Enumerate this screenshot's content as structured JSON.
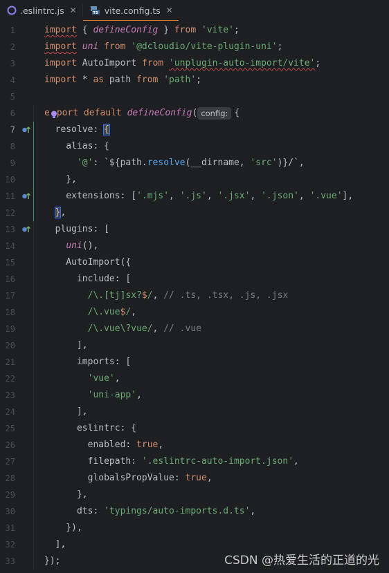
{
  "tabs": [
    {
      "label": ".eslintrc.js",
      "icon": "eslint-icon",
      "active": false
    },
    {
      "label": "vite.config.ts",
      "icon": "typescript-file-icon",
      "active": true
    }
  ],
  "tab_close_symbol": "✕",
  "watermark": "CSDN @热爱生活的正道的光",
  "inlay_hint": "config:",
  "current_line": 7,
  "gutter_markers": [
    7,
    11,
    13
  ],
  "lines": [
    {
      "n": 1,
      "html": "<span class='kw typo'>import</span> { <span class='fn'>defineConfig</span> } <span class='kw'>from</span> <span class='str'>'vite'</span>;"
    },
    {
      "n": 2,
      "html": "<span class='kw typo'>import</span> <span class='fn'>uni</span> <span class='kw'>from</span> <span class='str'>'@dcloudio/vite-plugin-uni'</span>;"
    },
    {
      "n": 3,
      "html": "<span class='kw'>import</span> AutoImport <span class='kw'>from</span> <span class='str typo'>'unplugin-auto-import/vite'</span>;"
    },
    {
      "n": 4,
      "html": "<span class='kw'>import</span> * <span class='kw'>as</span> path <span class='kw'>from</span> <span class='str'>'path'</span>;"
    },
    {
      "n": 5,
      "html": ""
    },
    {
      "n": 6,
      "html": "<span class='kw'>ex</span>  <span class='kw'>port default</span> <span class='fn'>defineConfig</span>(HINT {"
    },
    {
      "n": 7,
      "html": "  <span class='plain'>resolve</span>: <span class='brace-hl'>{</span>"
    },
    {
      "n": 8,
      "html": "    alias: {"
    },
    {
      "n": 9,
      "html": "      <span class='str'>'@'</span>: `${path.<span class='re'>resolve</span>(__dirname, <span class='str'>'src'</span>)}/`,"
    },
    {
      "n": 10,
      "html": "    },"
    },
    {
      "n": 11,
      "html": "    extensions: [<span class='str'>'.mjs'</span>, <span class='str'>'.js'</span>, <span class='str'>'.jsx'</span>, <span class='str'>'.json'</span>, <span class='str'>'.vue'</span>],"
    },
    {
      "n": 12,
      "html": "  <span class='brace-hl'>}</span>,"
    },
    {
      "n": 13,
      "html": "  plugins: ["
    },
    {
      "n": 14,
      "html": "    <span class='fn'>uni</span>(),"
    },
    {
      "n": 15,
      "html": "    AutoImport({"
    },
    {
      "n": 16,
      "html": "      include: ["
    },
    {
      "n": 17,
      "html": "        <span class='str'>/\\.[tj]sx?<span class='kw'>$</span>/</span>, <span class='cm'>// .ts, .tsx, .js, .jsx</span>"
    },
    {
      "n": 18,
      "html": "        <span class='str'>/\\.vue<span class='kw'>$</span>/</span>,"
    },
    {
      "n": 19,
      "html": "        <span class='str'>/\\.vue\\?vue/</span>, <span class='cm'>// .vue</span>"
    },
    {
      "n": 20,
      "html": "      ],"
    },
    {
      "n": 21,
      "html": "      imports: ["
    },
    {
      "n": 22,
      "html": "        <span class='str'>'vue'</span>,"
    },
    {
      "n": 23,
      "html": "        <span class='str'>'uni-app'</span>,"
    },
    {
      "n": 24,
      "html": "      ],"
    },
    {
      "n": 25,
      "html": "      eslintrc: {"
    },
    {
      "n": 26,
      "html": "        enabled: <span class='kw'>true</span>,"
    },
    {
      "n": 27,
      "html": "        filepath: <span class='str'>'.eslintrc-auto-import.json'</span>,"
    },
    {
      "n": 28,
      "html": "        globalsPropValue: <span class='kw'>true</span>,"
    },
    {
      "n": 29,
      "html": "      },"
    },
    {
      "n": 30,
      "html": "      dts: <span class='str'>'typings/auto-imports.d.ts'</span>,"
    },
    {
      "n": 31,
      "html": "    }),"
    },
    {
      "n": 32,
      "html": "  ],"
    },
    {
      "n": 33,
      "html": "});"
    }
  ]
}
